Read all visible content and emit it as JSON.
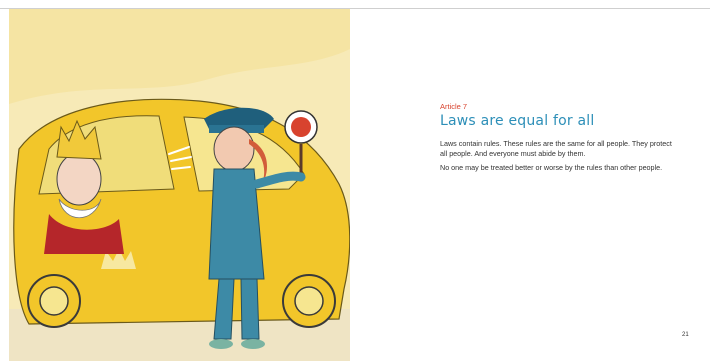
{
  "article": {
    "number": "Article 7",
    "title": "Laws are equal for all",
    "paragraphs": [
      "Laws contain rules. These rules are the same for all people. They protect all people. And everyone must abide by them.",
      "No one may be treated better or worse by the rules than other people."
    ]
  },
  "page_number": "21",
  "colors": {
    "accent_red": "#d8432e",
    "title_blue": "#2d8fb8",
    "car_yellow": "#f2c62a",
    "uniform_teal": "#3d8aa6"
  }
}
